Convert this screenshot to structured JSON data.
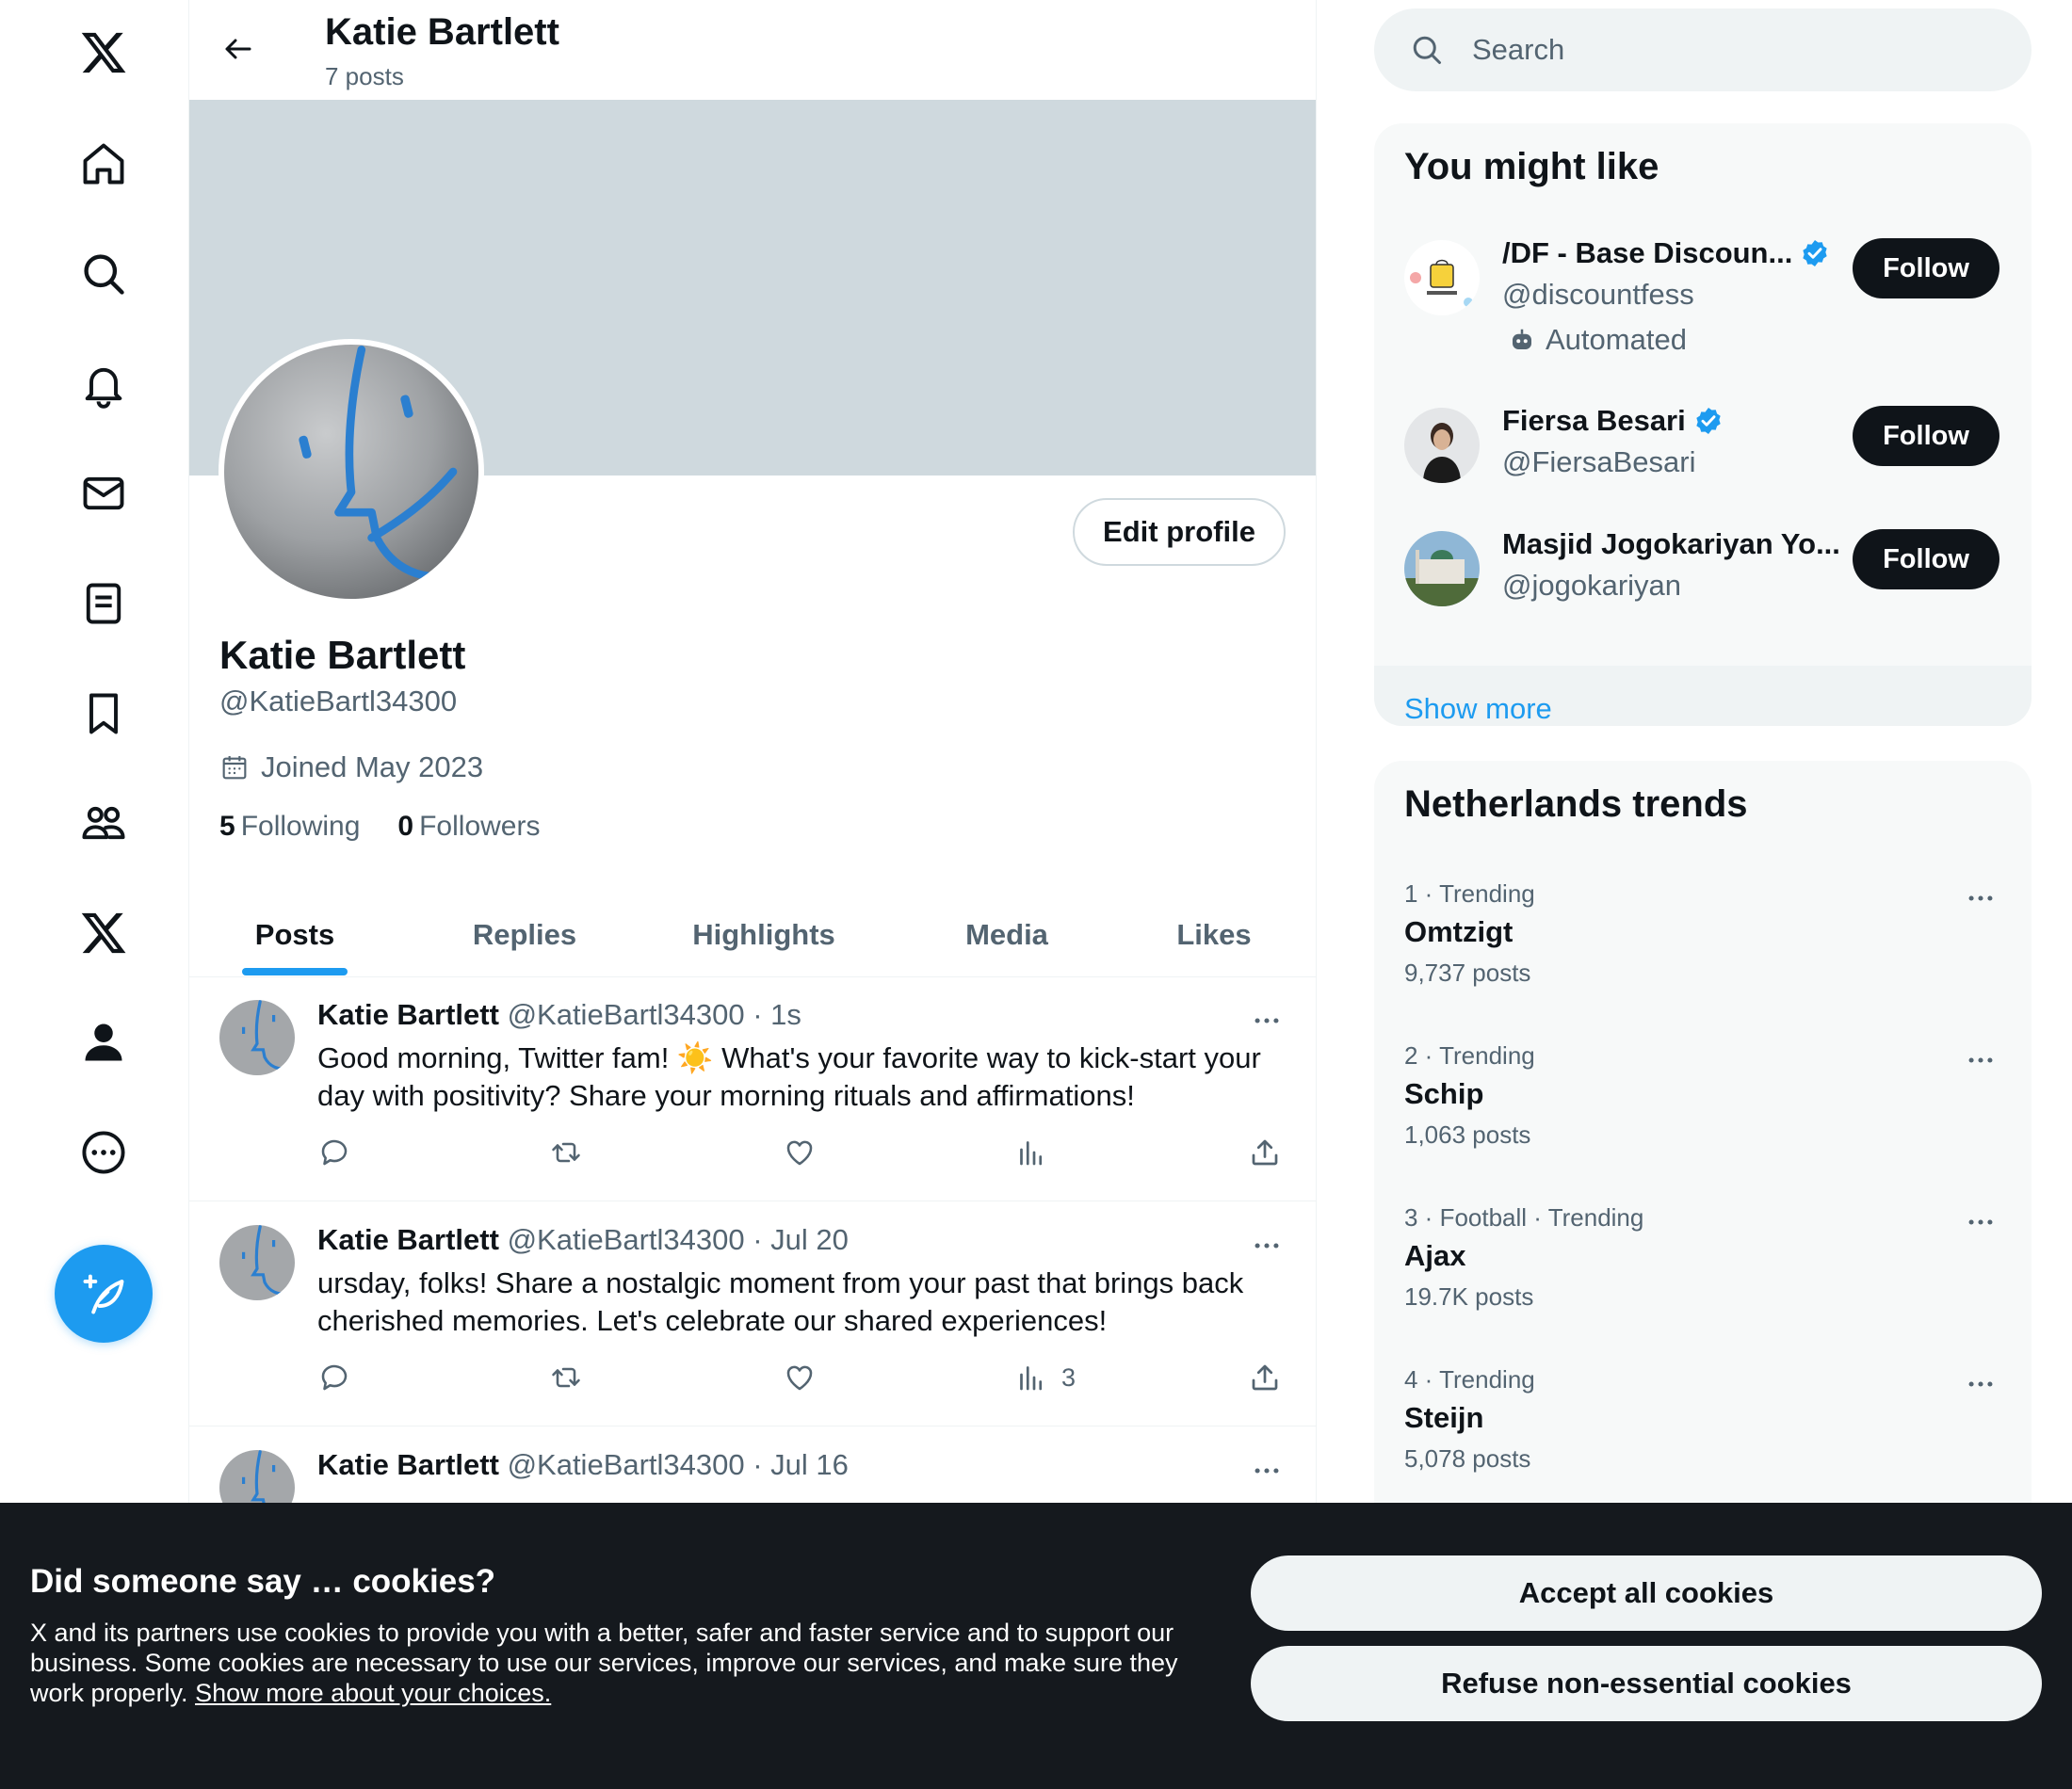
{
  "nav": {
    "items": [
      "x-logo",
      "home",
      "explore",
      "notifications",
      "messages",
      "lists",
      "bookmarks",
      "communities",
      "premium",
      "profile",
      "more"
    ],
    "compose_label": "Post"
  },
  "header": {
    "name": "Katie Bartlett",
    "posts_count": "7 posts"
  },
  "profile": {
    "edit_label": "Edit profile",
    "name": "Katie Bartlett",
    "handle": "@KatieBartl34300",
    "joined": "Joined May 2023",
    "following_count": "5",
    "following_label": "Following",
    "followers_count": "0",
    "followers_label": "Followers"
  },
  "tabs": [
    {
      "label": "Posts",
      "active": true
    },
    {
      "label": "Replies",
      "active": false
    },
    {
      "label": "Highlights",
      "active": false
    },
    {
      "label": "Media",
      "active": false
    },
    {
      "label": "Likes",
      "active": false
    }
  ],
  "posts": [
    {
      "name": "Katie Bartlett",
      "meta": "@KatieBartl34300 · 1s",
      "text": "Good morning, Twitter fam! ☀️ What's your favorite way to kick-start your day with positivity? Share your morning rituals and affirmations!",
      "views": ""
    },
    {
      "name": "Katie Bartlett",
      "meta": "@KatieBartl34300 · Jul 20",
      "text": "ursday, folks! Share a nostalgic moment from your past that brings back cherished memories. Let's celebrate our shared experiences!",
      "views": "3"
    },
    {
      "name": "Katie Bartlett",
      "meta": "@KatieBartl34300 · Jul 16",
      "text": "",
      "views": ""
    }
  ],
  "search": {
    "placeholder": "Search"
  },
  "suggestions": {
    "title": "You might like",
    "items": [
      {
        "name": "/DF - Base Discoun...",
        "handle": "@discountfess",
        "automated": "Automated",
        "follow": "Follow"
      },
      {
        "name": "Fiersa Besari",
        "handle": "@FiersaBesari",
        "automated": "",
        "follow": "Follow"
      },
      {
        "name": "Masjid Jogokariyan Yo...",
        "handle": "@jogokariyan",
        "automated": "",
        "follow": "Follow"
      }
    ],
    "show_more": "Show more"
  },
  "trends": {
    "title": "Netherlands trends",
    "items": [
      {
        "meta": "1 · Trending",
        "name": "Omtzigt",
        "count": "9,737 posts"
      },
      {
        "meta": "2 · Trending",
        "name": "Schip",
        "count": "1,063 posts"
      },
      {
        "meta": "3 · Football · Trending",
        "name": "Ajax",
        "count": "19.7K posts"
      },
      {
        "meta": "4 · Trending",
        "name": "Steijn",
        "count": "5,078 posts"
      }
    ]
  },
  "cookie": {
    "title": "Did someone say … cookies?",
    "text": "X and its partners use cookies to provide you with a better, safer and faster service and to support our business. Some cookies are necessary to use our services, improve our services, and make sure they work properly. ",
    "link": "Show more about your choices.",
    "accept": "Accept all cookies",
    "refuse": "Refuse non-essential cookies"
  },
  "colors": {
    "accent": "#1d9bf0",
    "text": "#0f1419",
    "muted": "#536471",
    "banner": "#cfd9de",
    "cookie_bg": "#15191e"
  }
}
